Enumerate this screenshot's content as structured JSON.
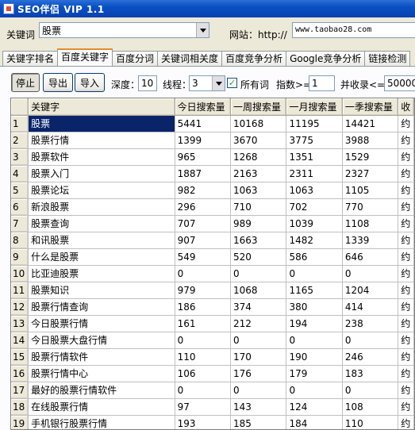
{
  "window": {
    "title": "SEO伴侣 VIP 1.1"
  },
  "search": {
    "keyword_label": "关键词",
    "keyword_value": "股票",
    "site_label": "网站：http://",
    "site_value": "www.taobao28.com"
  },
  "tabs": [
    {
      "label": "关键字排名",
      "active": false
    },
    {
      "label": "百度关键字",
      "active": true
    },
    {
      "label": "百度分词",
      "active": false
    },
    {
      "label": "关键词相关度",
      "active": false
    },
    {
      "label": "百度竞争分析",
      "active": false
    },
    {
      "label": "Google竞争分析",
      "active": false
    },
    {
      "label": "链接检测",
      "active": false
    }
  ],
  "toolbar": {
    "stop_label": "停止",
    "export_label": "导出",
    "import_label": "导入",
    "depth_label": "深度：",
    "depth_value": "10",
    "threads_label": "线程：",
    "threads_value": "3",
    "all_words_label": "所有词",
    "all_words_checked": "✓",
    "index_label": "指数>=",
    "index_value": "1",
    "indexed_label": "并收录<=",
    "indexed_value": "50000"
  },
  "table": {
    "columns": [
      "关键字",
      "今日搜索量",
      "一周搜索量",
      "一月搜索量",
      "一季搜索量",
      "收"
    ],
    "rows": [
      {
        "n": "1",
        "kw": "股票",
        "d": "5441",
        "w": "10168",
        "m": "11195",
        "q": "14421",
        "s": "约"
      },
      {
        "n": "2",
        "kw": "股票行情",
        "d": "1399",
        "w": "3670",
        "m": "3775",
        "q": "3988",
        "s": "约"
      },
      {
        "n": "3",
        "kw": "股票软件",
        "d": "965",
        "w": "1268",
        "m": "1351",
        "q": "1529",
        "s": "约"
      },
      {
        "n": "4",
        "kw": "股票入门",
        "d": "1887",
        "w": "2163",
        "m": "2311",
        "q": "2327",
        "s": "约"
      },
      {
        "n": "5",
        "kw": "股票论坛",
        "d": "982",
        "w": "1063",
        "m": "1063",
        "q": "1105",
        "s": "约"
      },
      {
        "n": "6",
        "kw": "新浪股票",
        "d": "296",
        "w": "710",
        "m": "702",
        "q": "770",
        "s": "约"
      },
      {
        "n": "7",
        "kw": "股票查询",
        "d": "707",
        "w": "989",
        "m": "1039",
        "q": "1108",
        "s": "约"
      },
      {
        "n": "8",
        "kw": "和讯股票",
        "d": "907",
        "w": "1663",
        "m": "1482",
        "q": "1339",
        "s": "约"
      },
      {
        "n": "9",
        "kw": "什么是股票",
        "d": "549",
        "w": "520",
        "m": "586",
        "q": "646",
        "s": "约"
      },
      {
        "n": "10",
        "kw": "比亚迪股票",
        "d": "0",
        "w": "0",
        "m": "0",
        "q": "0",
        "s": "约"
      },
      {
        "n": "11",
        "kw": "股票知识",
        "d": "979",
        "w": "1068",
        "m": "1165",
        "q": "1204",
        "s": "约"
      },
      {
        "n": "12",
        "kw": "股票行情查询",
        "d": "186",
        "w": "374",
        "m": "380",
        "q": "414",
        "s": "约"
      },
      {
        "n": "13",
        "kw": "今日股票行情",
        "d": "161",
        "w": "212",
        "m": "194",
        "q": "238",
        "s": "约"
      },
      {
        "n": "14",
        "kw": "今日股票大盘行情",
        "d": "0",
        "w": "0",
        "m": "0",
        "q": "0",
        "s": "约"
      },
      {
        "n": "15",
        "kw": "股票行情软件",
        "d": "110",
        "w": "170",
        "m": "190",
        "q": "246",
        "s": "约"
      },
      {
        "n": "16",
        "kw": "股票行情中心",
        "d": "106",
        "w": "176",
        "m": "179",
        "q": "183",
        "s": "约"
      },
      {
        "n": "17",
        "kw": "最好的股票行情软件",
        "d": "0",
        "w": "0",
        "m": "0",
        "q": "0",
        "s": "约"
      },
      {
        "n": "18",
        "kw": "在线股票行情",
        "d": "97",
        "w": "143",
        "m": "124",
        "q": "108",
        "s": "约"
      },
      {
        "n": "19",
        "kw": "手机银行股票行情",
        "d": "193",
        "w": "185",
        "m": "184",
        "q": "110",
        "s": "约"
      }
    ]
  }
}
